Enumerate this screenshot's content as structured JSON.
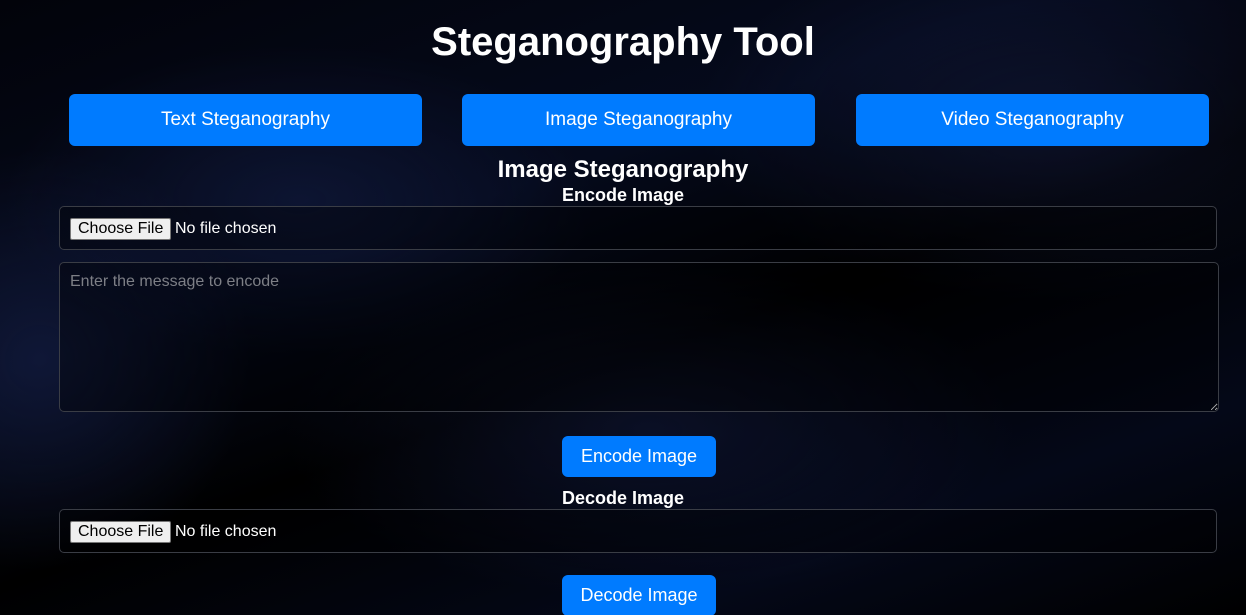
{
  "header": {
    "title": "Steganography Tool"
  },
  "nav": {
    "items": [
      {
        "label": "Text Steganography"
      },
      {
        "label": "Image Steganography"
      },
      {
        "label": "Video Steganography"
      }
    ]
  },
  "section": {
    "title": "Image Steganography"
  },
  "encode": {
    "heading": "Encode Image",
    "file_button": "Choose File",
    "file_status": "No file chosen",
    "message_placeholder": "Enter the message to encode",
    "message_value": "",
    "submit_label": "Encode Image"
  },
  "decode": {
    "heading": "Decode Image",
    "file_button": "Choose File",
    "file_status": "No file chosen",
    "submit_label": "Decode Image"
  },
  "colors": {
    "accent": "#007bff",
    "background": "#000000",
    "text": "#ffffff"
  }
}
